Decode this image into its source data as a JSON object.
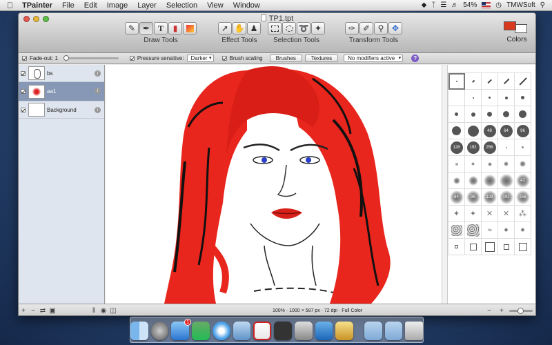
{
  "menubar": {
    "app_name": "TPainter",
    "menus": [
      "File",
      "Edit",
      "Image",
      "Layer",
      "Selection",
      "View",
      "Window"
    ],
    "battery": "54%",
    "user": "TMWSoft"
  },
  "window": {
    "title": "TP1.tpt"
  },
  "toolbar": {
    "groups": [
      {
        "label": "Draw Tools",
        "tools": [
          "pencil-icon",
          "brush-icon",
          "text-icon",
          "eraser-icon",
          "gradient-icon"
        ]
      },
      {
        "label": "Effect Tools",
        "tools": [
          "arrow-icon",
          "smudge-icon",
          "stamp-icon"
        ]
      },
      {
        "label": "Selection Tools",
        "tools": [
          "rect-select-icon",
          "ellipse-select-icon",
          "lasso-icon",
          "magic-wand-icon"
        ]
      },
      {
        "label": "Transform Tools",
        "tools": [
          "eyedropper-icon",
          "pen-icon",
          "zoom-icon",
          "move-icon"
        ]
      }
    ],
    "colors_label": "Colors",
    "foreground_color": "#d93a1f",
    "background_color": "#ffffff"
  },
  "options": {
    "fade_out_label": "Fade-out: 1",
    "pressure_label": "Pressure sensitive:",
    "blend_mode": "Darker",
    "brush_scaling_label": "Brush scaling",
    "brushes_button": "Brushes",
    "textures_button": "Textures",
    "modifiers": "No modifiers active",
    "help": "?"
  },
  "layers": [
    {
      "name": "bs",
      "active": false
    },
    {
      "name": "aa1",
      "active": true
    },
    {
      "name": "Background",
      "active": false
    }
  ],
  "brush_labels": [
    "48",
    "64",
    "96",
    "128",
    "192",
    "256",
    "42",
    "64",
    "96",
    "128",
    "192",
    "256"
  ],
  "status": {
    "info": "100% · 1000 × 587 px · 72 dpi · Full Color"
  },
  "colors": {
    "accent": "#d93a1f",
    "selection": "#8798b6"
  }
}
